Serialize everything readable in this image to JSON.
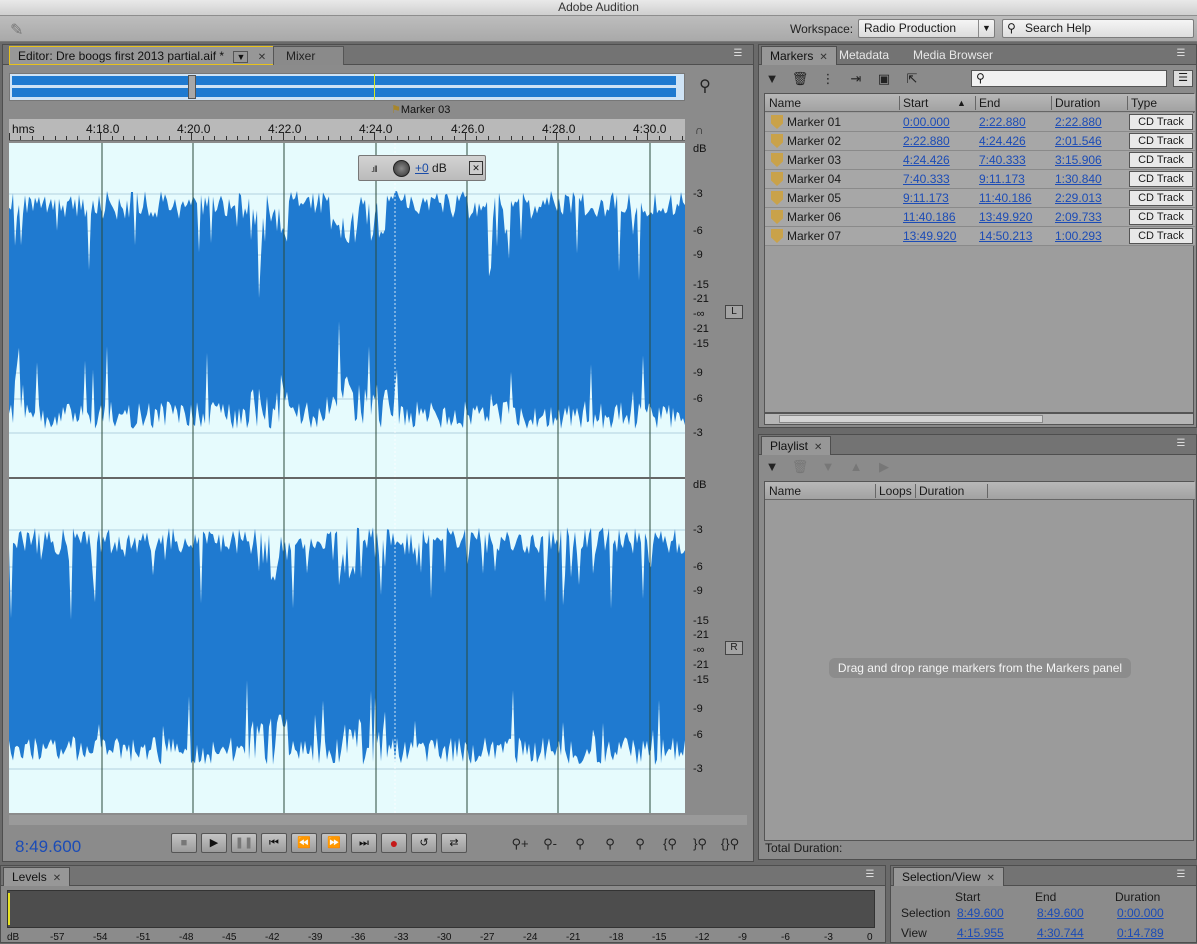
{
  "app": {
    "title": "Adobe Audition"
  },
  "workspace": {
    "label": "Workspace:",
    "value": "Radio Production",
    "search_placeholder": "Search Help"
  },
  "editor": {
    "tab_label": "Editor: Dre boogs first 2013 partial.aif *",
    "mixer_tab": "Mixer",
    "marker_label": "Marker 03",
    "ruler_unit": "hms",
    "ruler_ticks": [
      "4:18.0",
      "4:20.0",
      "4:22.0",
      "4:24.0",
      "4:26.0",
      "4:28.0",
      "4:30.0"
    ],
    "db_unit": "dB",
    "db_labels": [
      "-3",
      "-6",
      "-9",
      "-15",
      "-21",
      "-∞",
      "-21",
      "-15",
      "-9",
      "-6",
      "-3"
    ],
    "channel_left": "L",
    "channel_right": "R",
    "hud": {
      "value": "+0",
      "unit": "dB"
    },
    "timecode": "8:49.600"
  },
  "transport": [
    "stop",
    "play",
    "pause",
    "move-to-previous",
    "rewind",
    "fast-forward",
    "move-to-next",
    "record",
    "loop",
    "skip-selection"
  ],
  "markers_panel": {
    "tabs": [
      "Markers",
      "Metadata",
      "Media Browser"
    ],
    "columns": [
      "Name",
      "Start",
      "End",
      "Duration",
      "Type"
    ],
    "rows": [
      {
        "name": "Marker 01",
        "start": "0:00.000",
        "end": "2:22.880",
        "duration": "2:22.880",
        "type": "CD Track"
      },
      {
        "name": "Marker 02",
        "start": "2:22.880",
        "end": "4:24.426",
        "duration": "2:01.546",
        "type": "CD Track"
      },
      {
        "name": "Marker 03",
        "start": "4:24.426",
        "end": "7:40.333",
        "duration": "3:15.906",
        "type": "CD Track"
      },
      {
        "name": "Marker 04",
        "start": "7:40.333",
        "end": "9:11.173",
        "duration": "1:30.840",
        "type": "CD Track"
      },
      {
        "name": "Marker 05",
        "start": "9:11.173",
        "end": "11:40.186",
        "duration": "2:29.013",
        "type": "CD Track"
      },
      {
        "name": "Marker 06",
        "start": "11:40.186",
        "end": "13:49.920",
        "duration": "2:09.733",
        "type": "CD Track"
      },
      {
        "name": "Marker 07",
        "start": "13:49.920",
        "end": "14:50.213",
        "duration": "1:00.293",
        "type": "CD Track"
      }
    ]
  },
  "playlist": {
    "tab": "Playlist",
    "columns": [
      "Name",
      "Loops",
      "Duration"
    ],
    "hint": "Drag and drop range markers from the Markers panel",
    "total_label": "Total Duration:"
  },
  "levels": {
    "tab": "Levels",
    "scale": [
      "dB",
      "-57",
      "-54",
      "-51",
      "-48",
      "-45",
      "-42",
      "-39",
      "-36",
      "-33",
      "-30",
      "-27",
      "-24",
      "-21",
      "-18",
      "-15",
      "-12",
      "-9",
      "-6",
      "-3",
      "0"
    ]
  },
  "selection_view": {
    "tab": "Selection/View",
    "headers": [
      "Start",
      "End",
      "Duration"
    ],
    "selection": {
      "label": "Selection",
      "start": "8:49.600",
      "end": "8:49.600",
      "duration": "0:00.000"
    },
    "view": {
      "label": "View",
      "start": "4:15.955",
      "end": "4:30.744",
      "duration": "0:14.789"
    }
  },
  "colors": {
    "waveform": "#1f7ad0",
    "waveform_bg": "#e6fbfd",
    "link": "#1c4cb6",
    "panel": "#8b8b8b"
  }
}
